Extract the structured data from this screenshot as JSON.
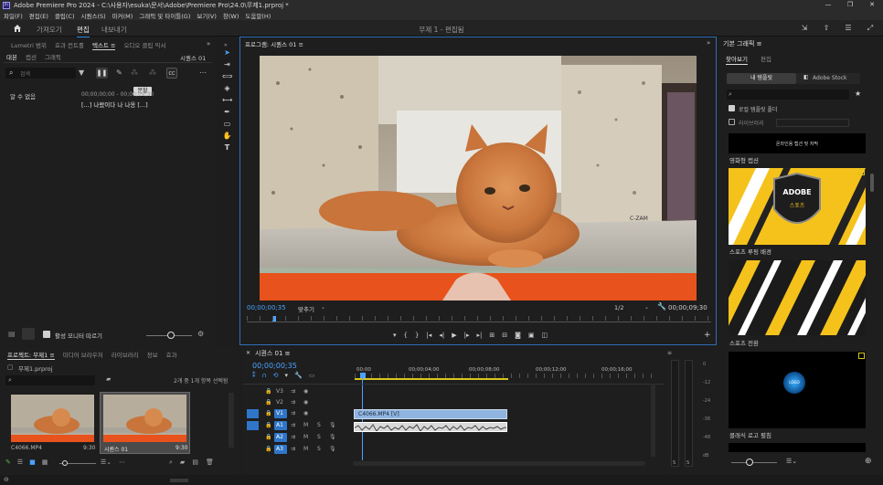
{
  "window": {
    "title": "Adobe Premiere Pro 2024 - C:\\사용자\\esuka\\문서\\Adobe\\Premiere Pro\\24.0\\무제1.prproj *",
    "logo_text": "Pr"
  },
  "menu": [
    "파일(F)",
    "편집(E)",
    "클립(C)",
    "시퀀스(S)",
    "마커(M)",
    "그래픽 및 타이틀(G)",
    "보기(V)",
    "창(W)",
    "도움말(H)"
  ],
  "workspace": {
    "tabs": [
      "가져오기",
      "편집",
      "내보내기"
    ],
    "active_tab": "편집",
    "project_title": "무제 1 - 편집됨"
  },
  "left_panel": {
    "tabs": [
      "Lumetri 범위",
      "효과 컨트롤",
      "텍스트 ≡",
      "오디오 클립 믹서"
    ],
    "sub_tabs": [
      "대본",
      "캡션",
      "그래픽"
    ],
    "sequence_name": "시퀀스 01",
    "search_placeholder": "검색",
    "tooltip": "분할",
    "speaker": "알 수 없음",
    "timecode_range": "00;00;00;00 - 00;00;09;30",
    "transcript": "[...] 나왔이다 나 나옹 [...]",
    "active_monitor_label": "활성 모니터 따르기"
  },
  "program_monitor": {
    "title": "프로그램: 시퀀스 01 ≡",
    "current_time": "00;00;00;35",
    "fit": "맞추기",
    "resolution": "1/2",
    "duration": "00;00;09;30"
  },
  "right_panel": {
    "title": "기본 그래픽 ≡",
    "tabs": [
      "찾아보기",
      "편집"
    ],
    "btn_my_templates": "내 템플릿",
    "btn_stock": "Adobe Stock",
    "checkbox_local": "로컬 템플릿 폴더",
    "checkbox_library": "라이브러리",
    "templates": [
      {
        "header": "온라인용 캡션 및 자막",
        "label": "영화형 캡션"
      },
      {
        "header": "",
        "label": "스포츠 루핑 배경",
        "badge_top": "ADOBE",
        "badge_bottom": "스포츠"
      },
      {
        "header": "",
        "label": "스포츠 전환"
      },
      {
        "header": "",
        "label": "클래식 로고 펼침",
        "logo_text": "LOGO"
      }
    ]
  },
  "project_panel": {
    "tabs": [
      "프로젝트: 무제1 ≡",
      "미디어 브라우저",
      "라이브러리",
      "정보",
      "효과"
    ],
    "file": "무제1.prproj",
    "selection_info": "2개 중 1개 항목 선택됨",
    "items": [
      {
        "name": "C4066.MP4",
        "duration": "9:30"
      },
      {
        "name": "시퀀스 01",
        "duration": "9:30"
      }
    ]
  },
  "timeline": {
    "title": "시퀀스 01 ≡",
    "current_time": "00;00;00;35",
    "ruler": [
      "00;00",
      "00;00;04;00",
      "00;00;08;00",
      "00;00;12;00",
      "00;00;16;00"
    ],
    "video_tracks": [
      "V3",
      "V2",
      "V1"
    ],
    "audio_tracks": [
      "A1",
      "A2",
      "A3"
    ],
    "clip_name": "C4066.MP4 [V]"
  },
  "meter": {
    "scale": [
      "0",
      "-12",
      "-24",
      "-36",
      "-48",
      "dB"
    ],
    "solo": [
      "S",
      "S"
    ]
  },
  "colors": {
    "accent": "#2d8ceb",
    "clip_video": "#8fb4e0",
    "timeline_in_out": "#d6c61e",
    "timecode": "#4aa3ff"
  }
}
